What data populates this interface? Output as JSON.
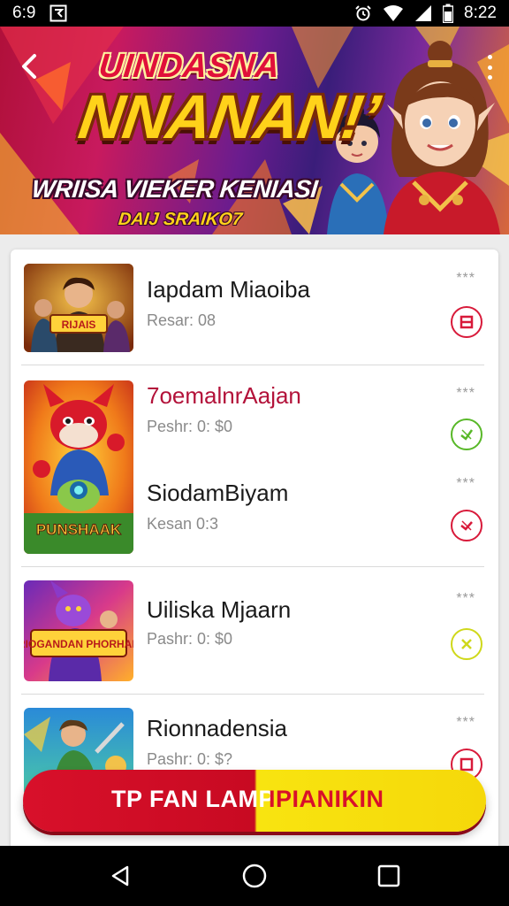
{
  "status_bar": {
    "left_text": "6:9",
    "time": "8:22",
    "icons": [
      "notification-square-icon",
      "alarm-icon",
      "wifi-icon",
      "signal-icon",
      "battery-icon"
    ]
  },
  "banner": {
    "kicker": "UINDASNA",
    "title": "NNANAN!’",
    "subtitle1": "WRIISA VIEKER KENIASI",
    "subtitle2": "DAIJ SRAIKO7",
    "back_icon": "chevron-left-icon",
    "more_icon": "more-vertical-icon"
  },
  "list": {
    "items": [
      {
        "title": "Iapdam Miaoiba",
        "subtitle": "Resar: 08",
        "menu": "***",
        "status": "red",
        "status_icon": "ban-icon"
      },
      {
        "title": "7oemalnrAajan",
        "subtitle": "Peshr: 0: $0",
        "menu": "***",
        "status": "green",
        "status_icon": "check-icon"
      },
      {
        "title": "SiodamBiyam",
        "subtitle": "Kesan 0:3",
        "menu": "***",
        "status": "red",
        "status_icon": "check-icon"
      },
      {
        "title": "Uiliska Mjaarn",
        "subtitle": "Pashr: 0: $0",
        "menu": "***",
        "status": "yellow",
        "status_icon": "close-icon"
      },
      {
        "title": "Rionnadensia",
        "subtitle": "Pashr: 0: $?",
        "menu": "***",
        "status": "red",
        "status_icon": "ban-icon"
      }
    ],
    "thumb_labels": [
      "RIJAIS",
      "PUNSHAAK",
      "FRIOGANDAN PHORHANT"
    ]
  },
  "cta": {
    "left_label": "TP FAN LAMP",
    "right_label": "IPIANIKIN"
  },
  "nav": {
    "icons": [
      "back-triangle-icon",
      "home-circle-icon",
      "recents-square-icon"
    ]
  },
  "colors": {
    "accent_red": "#d8102a",
    "accent_yellow": "#f8e410",
    "status_green": "#58b828",
    "status_yellow": "#cfd81a",
    "title_red": "#b3123a"
  }
}
